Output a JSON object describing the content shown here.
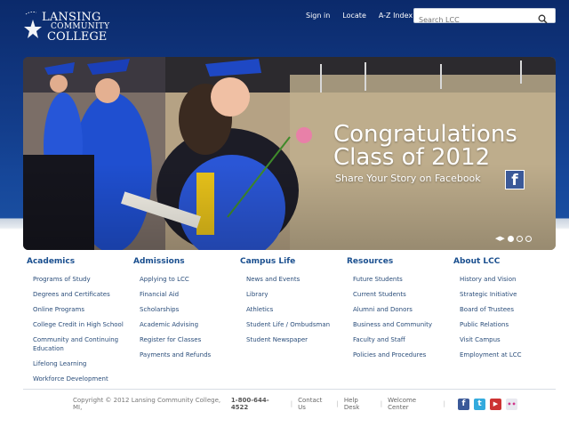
{
  "logo": {
    "line1": "LANSING",
    "line2": "COMMUNITY",
    "line3": "COLLEGE"
  },
  "topnav": [
    "Sign in",
    "Locate",
    "A-Z Index"
  ],
  "search": {
    "placeholder": "Search LCC"
  },
  "hero": {
    "title_line1": "Congratulations",
    "title_line2": "Class of 2012",
    "subtitle": "Share Your Story on Facebook",
    "fb_letter": "f"
  },
  "columns": [
    {
      "heading": "Academics",
      "items": [
        "Programs of Study",
        "Degrees and Certificates",
        "Online Programs",
        "College Credit in High School",
        "Community and Continuing Education",
        "Lifelong Learning",
        "Workforce Development"
      ]
    },
    {
      "heading": "Admissions",
      "items": [
        "Applying to LCC",
        "Financial Aid",
        "Scholarships",
        "Academic Advising",
        "Register for Classes",
        "Payments and Refunds"
      ]
    },
    {
      "heading": "Campus Life",
      "items": [
        "News and Events",
        "Library",
        "Athletics",
        "Student Life / Ombudsman",
        "Student Newspaper"
      ]
    },
    {
      "heading": "Resources",
      "items": [
        "Future Students",
        "Current Students",
        "Alumni and Donors",
        "Business and Community",
        "Faculty and Staff",
        "Policies and Procedures"
      ]
    },
    {
      "heading": "About LCC",
      "items": [
        "History and Vision",
        "Strategic Initiative",
        "Board of Trustees",
        "Public Relations",
        "Visit Campus",
        "Employment at LCC"
      ]
    }
  ],
  "footer": {
    "copyright": "Copyright © 2012 Lansing Community College, MI,",
    "phone": "1-800-644-4522",
    "links": [
      "Contact Us",
      "Help Desk",
      "Welcome Center"
    ]
  },
  "social": [
    {
      "icon": "facebook-icon",
      "letter": "f",
      "color": "#3b5998"
    },
    {
      "icon": "twitter-icon",
      "letter": "t",
      "color": "#33aadd"
    },
    {
      "icon": "youtube-icon",
      "letter": "▶",
      "color": "#cc3333"
    },
    {
      "icon": "flickr-icon",
      "letter": "••",
      "color": "#e8e8ef"
    }
  ]
}
